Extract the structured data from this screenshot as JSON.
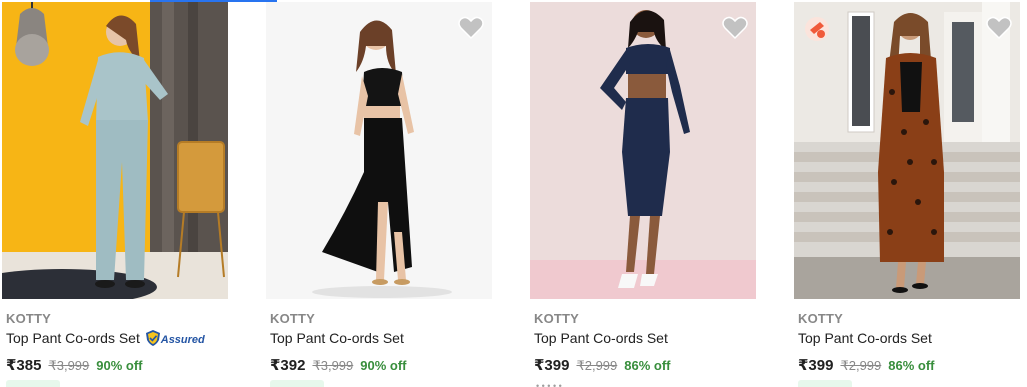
{
  "products": [
    {
      "brand": "KOTTY",
      "title": "Top Pant Co-ords Set",
      "assured": true,
      "assured_label": "Assured",
      "price": "₹385",
      "mrp": "₹3,999",
      "discount": "90% off"
    },
    {
      "brand": "KOTTY",
      "title": "Top Pant Co-ords Set",
      "assured": false,
      "price": "₹392",
      "mrp": "₹3,999",
      "discount": "90% off"
    },
    {
      "brand": "KOTTY",
      "title": "Top Pant Co-ords Set",
      "assured": false,
      "price": "₹399",
      "mrp": "₹2,999",
      "discount": "86% off"
    },
    {
      "brand": "KOTTY",
      "title": "Top Pant Co-ords Set",
      "assured": false,
      "price": "₹399",
      "mrp": "₹2,999",
      "discount": "86% off"
    }
  ],
  "colors": {
    "price_text": "#212121",
    "mrp_text": "#878787",
    "discount_text": "#388e3c",
    "assured_blue": "#2455a4",
    "wishlist_icon": "#c2c2c2",
    "accent": "#2874f0"
  },
  "icons": {
    "wishlist": "heart-icon",
    "assured": "assured-shield-icon",
    "compare": "compare-icon"
  }
}
